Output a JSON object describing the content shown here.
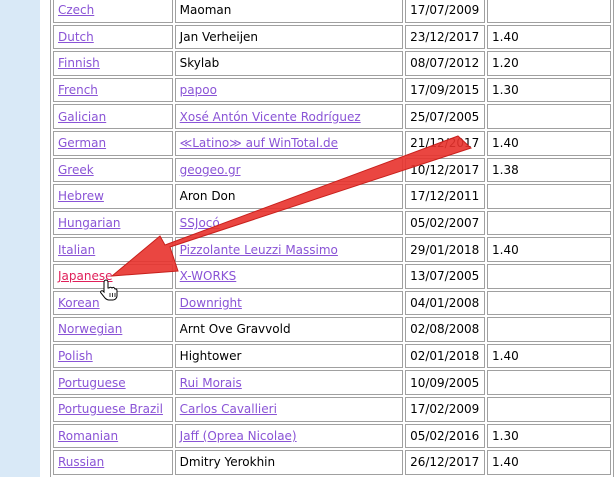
{
  "rows": [
    {
      "language": "Czech",
      "translator": "Maoman",
      "translator_link": false,
      "date": "17/07/2009",
      "version": ""
    },
    {
      "language": "Dutch",
      "translator": "Jan Verheijen",
      "translator_link": false,
      "date": "23/12/2017",
      "version": "1.40"
    },
    {
      "language": "Finnish",
      "translator": "Skylab",
      "translator_link": false,
      "date": "08/07/2012",
      "version": "1.20"
    },
    {
      "language": "French",
      "translator": "papoo",
      "translator_link": true,
      "date": "17/09/2015",
      "version": "1.30"
    },
    {
      "language": "Galician",
      "translator": "Xosé Antón Vicente Rodríguez",
      "translator_link": true,
      "date": "25/07/2005",
      "version": ""
    },
    {
      "language": "German",
      "translator": "≪Latino≫ auf WinTotal.de",
      "translator_link": true,
      "date": "21/12/2017",
      "version": "1.40"
    },
    {
      "language": "Greek",
      "translator": "geogeo.gr",
      "translator_link": true,
      "date": "10/12/2017",
      "version": "1.38"
    },
    {
      "language": "Hebrew",
      "translator": "Aron Don",
      "translator_link": false,
      "date": "17/12/2011",
      "version": ""
    },
    {
      "language": "Hungarian",
      "translator": "SSJocó",
      "translator_link": true,
      "date": "05/02/2007",
      "version": ""
    },
    {
      "language": "Italian",
      "translator": "Pizzolante Leuzzi Massimo",
      "translator_link": true,
      "date": "29/01/2018",
      "version": "1.40"
    },
    {
      "language": "Japanese",
      "translator": "X-WORKS",
      "translator_link": true,
      "date": "13/07/2005",
      "version": "",
      "active": true
    },
    {
      "language": "Korean",
      "translator": "Downright",
      "translator_link": true,
      "date": "04/01/2008",
      "version": ""
    },
    {
      "language": "Norwegian",
      "translator": "Arnt Ove Gravvold",
      "translator_link": false,
      "date": "02/08/2008",
      "version": ""
    },
    {
      "language": "Polish",
      "translator": "Hightower",
      "translator_link": false,
      "date": "02/01/2018",
      "version": "1.40"
    },
    {
      "language": "Portuguese",
      "translator": "Rui Morais",
      "translator_link": true,
      "date": "10/09/2005",
      "version": ""
    },
    {
      "language": "Portuguese Brazil",
      "translator": "Carlos Cavallieri",
      "translator_link": true,
      "date": "17/02/2009",
      "version": ""
    },
    {
      "language": "Romanian",
      "translator": "Jaff (Oprea Nicolae)",
      "translator_link": true,
      "date": "05/02/2016",
      "version": "1.30"
    },
    {
      "language": "Russian",
      "translator": "Dmitry Yerokhin",
      "translator_link": false,
      "date": "26/12/2017",
      "version": "1.40"
    }
  ],
  "colors": {
    "background": "#d9e9f7",
    "link": "#8a54d6",
    "link_active": "#e0205a",
    "border": "#a0a0a0",
    "arrow": "#e8322c"
  },
  "annotation": {
    "icon": "red-arrow-icon",
    "cursor_icon": "hand-pointer-icon"
  }
}
